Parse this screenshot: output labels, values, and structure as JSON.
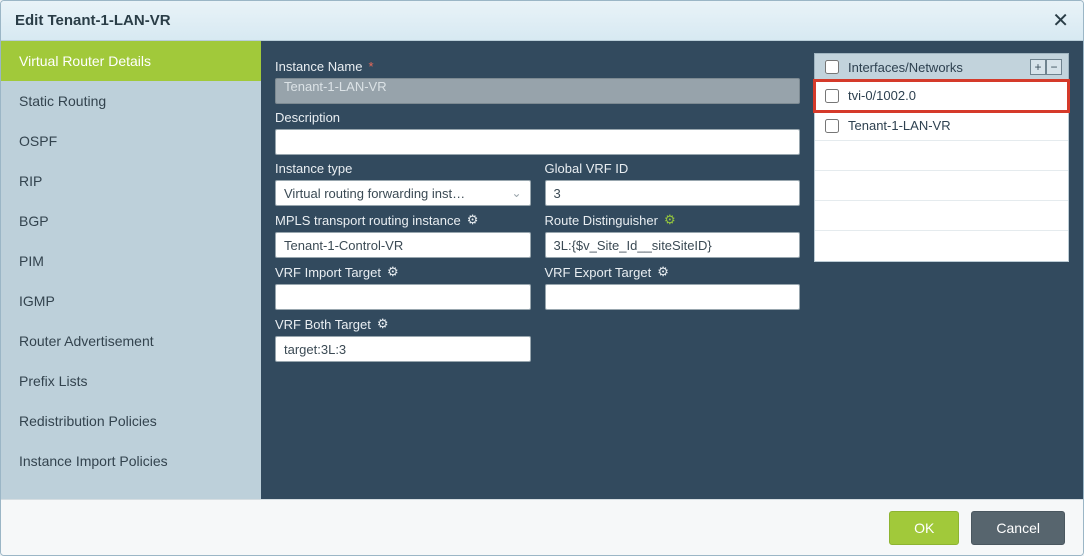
{
  "titlebar": {
    "title": "Edit Tenant-1-LAN-VR"
  },
  "sidebar": {
    "items": [
      {
        "label": "Virtual Router Details",
        "active": true
      },
      {
        "label": "Static Routing"
      },
      {
        "label": "OSPF"
      },
      {
        "label": "RIP"
      },
      {
        "label": "BGP"
      },
      {
        "label": "PIM"
      },
      {
        "label": "IGMP"
      },
      {
        "label": "Router Advertisement"
      },
      {
        "label": "Prefix Lists"
      },
      {
        "label": "Redistribution Policies"
      },
      {
        "label": "Instance Import Policies"
      }
    ]
  },
  "form": {
    "instance_name_label": "Instance Name",
    "instance_name_value": "Tenant-1-LAN-VR",
    "description_label": "Description",
    "description_value": "",
    "instance_type_label": "Instance type",
    "instance_type_value": "Virtual routing forwarding inst…",
    "global_vrf_id_label": "Global VRF ID",
    "global_vrf_id_value": "3",
    "mpls_label": "MPLS transport routing instance",
    "mpls_value": "Tenant-1-Control-VR",
    "rd_label": "Route Distinguisher",
    "rd_value": "3L:{$v_Site_Id__siteSiteID}",
    "vrf_import_label": "VRF Import Target",
    "vrf_import_value": "",
    "vrf_export_label": "VRF Export Target",
    "vrf_export_value": "",
    "vrf_both_label": "VRF Both Target",
    "vrf_both_value": "target:3L:3"
  },
  "interfaces": {
    "header": "Interfaces/Networks",
    "rows": [
      {
        "label": "tvi-0/1002.0",
        "highlight": true
      },
      {
        "label": "Tenant-1-LAN-VR"
      }
    ]
  },
  "footer": {
    "ok": "OK",
    "cancel": "Cancel"
  },
  "icons": {
    "gear": "⚙",
    "chevron_down": "⌄",
    "plus": "+",
    "minus": "−",
    "close": "✕",
    "required": "*"
  }
}
